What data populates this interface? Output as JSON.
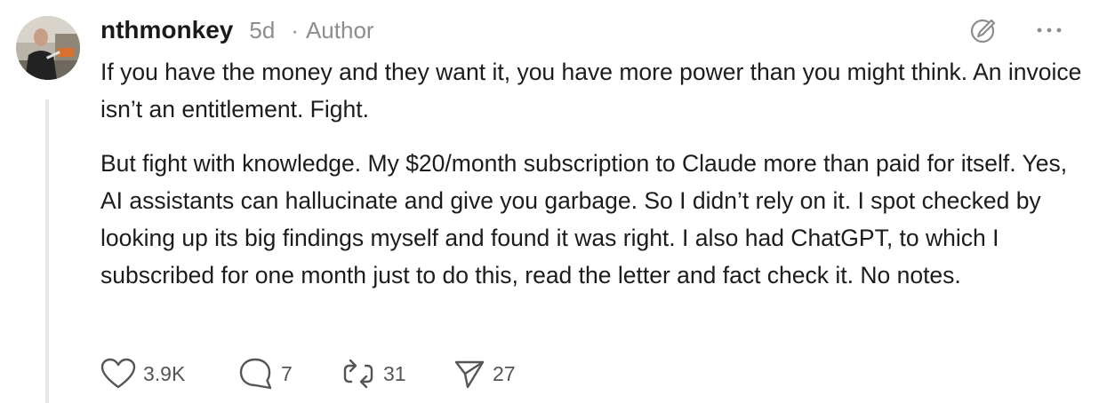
{
  "comment": {
    "username": "nthmonkey",
    "timestamp": "5d",
    "separator": "·",
    "author_badge": "Author",
    "paragraphs": [
      "If you have the money and they want it, you have more power than you might think. An invoice isn’t an entitlement. Fight.",
      "But fight with knowledge. My $20/month subscription to Claude more than paid for itself. Yes, AI assistants can hallucinate and give you garbage. So I didn’t rely on it. I spot checked by looking up its big findings myself and found it was right. I also had ChatGPT, to which I subscribed for one month just to do this, read the letter and fact check it. No notes."
    ],
    "actions": {
      "likes": "3.9K",
      "replies": "7",
      "restacks": "31",
      "shares": "27"
    }
  },
  "icons": {
    "edit": "edit-pencil-circle-icon",
    "more": "more-horizontal-icon",
    "like": "heart-icon",
    "reply": "comment-bubble-icon",
    "restack": "restack-arrows-icon",
    "share": "share-paper-plane-icon"
  },
  "colors": {
    "text": "#1c1c1c",
    "muted": "#8d8d8d",
    "icon": "#555555",
    "thread_line": "#e6e6e6"
  }
}
